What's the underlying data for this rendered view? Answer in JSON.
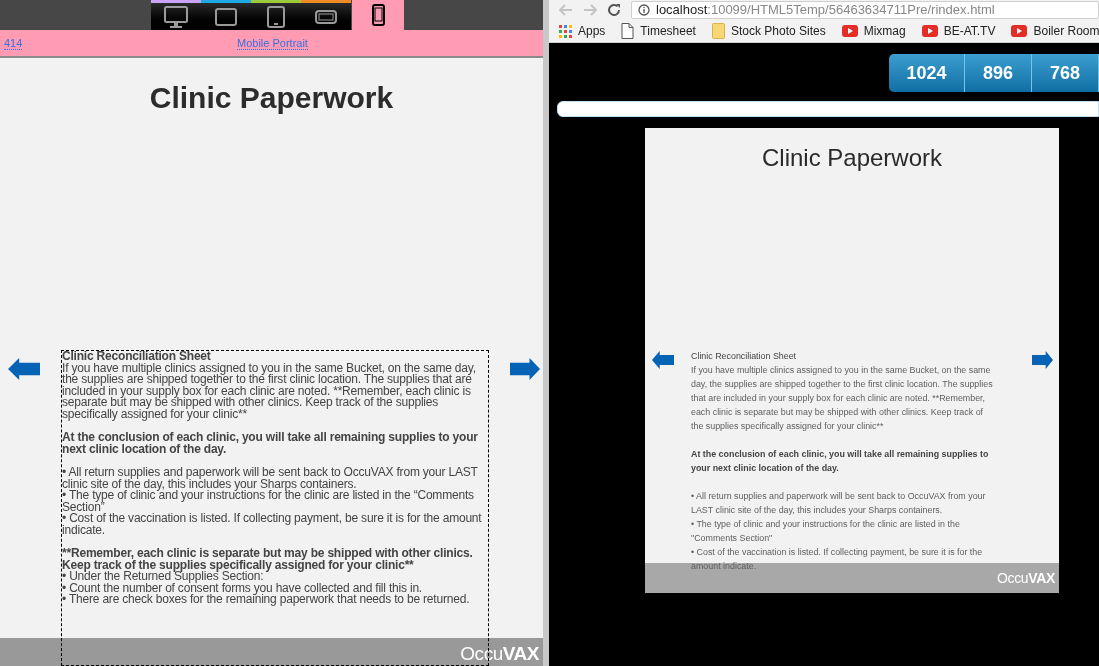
{
  "left_pane": {
    "device_tabs": [
      {
        "kind": "desktop",
        "selected": false,
        "color": "#c9a3f5"
      },
      {
        "kind": "tablet_landscape",
        "selected": false,
        "color": "#1ea8e6"
      },
      {
        "kind": "tablet_portrait",
        "selected": false,
        "color": "#9ccb3b"
      },
      {
        "kind": "phone_landscape",
        "selected": false,
        "color": "#f08a24"
      },
      {
        "kind": "phone_portrait",
        "selected": true,
        "color": "#ff9bb3"
      }
    ],
    "ruler": {
      "width_label": "414",
      "device_label": "Mobile Portrait"
    },
    "page": {
      "title": "Clinic Paperwork",
      "logo": "Occu**VAX**",
      "blocks": [
        {
          "kind": "heading",
          "text": "Clinic Reconciliation Sheet",
          "gap_before": false
        },
        {
          "kind": "paragraph",
          "text": "If you have multiple clinics assigned to you in the same Bucket, on the same day, the supplies are shipped together to the first clinic location. The supplies that are included in your supply box for each clinic are noted. **Remember, each clinic is separate but may be shipped with other clinics.  Keep track of the supplies specifically assigned for your clinic**",
          "gap_before": false
        },
        {
          "kind": "strong",
          "text": "At the conclusion of each clinic, you will take all remaining supplies to your next clinic location of the day.",
          "gap_before": true
        },
        {
          "kind": "paragraph",
          "text": "• All return supplies and paperwork will be sent back to OccuVAX from your LAST clinic site of the day, this includes your Sharps containers.",
          "gap_before": true
        },
        {
          "kind": "paragraph",
          "text": "• The type of clinic and your instructions for the clinic are listed in the “Comments Section”",
          "gap_before": false
        },
        {
          "kind": "paragraph",
          "text": "• Cost of the vaccination is listed.  If collecting payment, be sure it is for the amount indicate.",
          "gap_before": false
        },
        {
          "kind": "strong",
          "text": "**Remember, each clinic is separate but may be shipped with other clinics. Keep track of the supplies specifically assigned for your clinic**",
          "gap_before": true
        },
        {
          "kind": "paragraph",
          "text": "• Under the Returned Supplies Section:",
          "gap_before": false
        },
        {
          "kind": "paragraph",
          "text": "• Count the number of consent forms you have collected and fill this in.",
          "gap_before": false
        },
        {
          "kind": "paragraph",
          "text": "• There are check boxes for the remaining paperwork that needs to be returned.",
          "gap_before": false
        }
      ]
    }
  },
  "right_pane": {
    "address": {
      "host": "localhost",
      "path": ":10099/HTML5Temp/56463634711Pre/rindex.html"
    },
    "bookmarks": [
      {
        "kind": "apps",
        "label": "Apps"
      },
      {
        "kind": "page",
        "label": "Timesheet"
      },
      {
        "kind": "folder",
        "label": "Stock Photo Sites"
      },
      {
        "kind": "video",
        "label": "Mixmag"
      },
      {
        "kind": "video",
        "label": "BE-AT.TV"
      },
      {
        "kind": "video",
        "label": "Boiler Room"
      }
    ],
    "width_buttons": [
      "1024",
      "896",
      "768"
    ],
    "slide": {
      "title": "Clinic Paperwork",
      "logo": "Occu**VAX**",
      "blocks": [
        {
          "kind": "heading",
          "text": "Clinic Reconciliation Sheet",
          "gap_before": false
        },
        {
          "kind": "paragraph",
          "text": "If you have multiple clinics assigned to you in the same Bucket, on the same day, the supplies are shipped together to the first clinic location. The supplies that are included in your supply box for each clinic are noted. **Remember, each clinic is separate but may be shipped with other clinics.  Keep track of the supplies specifically assigned for your clinic**",
          "gap_before": false
        },
        {
          "kind": "strong",
          "text": "At the conclusion of each clinic, you will take all remaining supplies to your next clinic location of the day.",
          "gap_before": true
        },
        {
          "kind": "paragraph",
          "text": "• All return supplies and paperwork will be sent back to OccuVAX from your LAST clinic site of the day, this includes your Sharps containers.",
          "gap_before": true
        },
        {
          "kind": "paragraph",
          "text": "• The type of clinic and your instructions for the clinic are listed in the \"Comments Section\"",
          "gap_before": false
        },
        {
          "kind": "paragraph",
          "text": "• Cost of the vaccination is listed.  If collecting payment, be sure it is for the amount indicate.",
          "gap_before": false
        }
      ]
    }
  }
}
